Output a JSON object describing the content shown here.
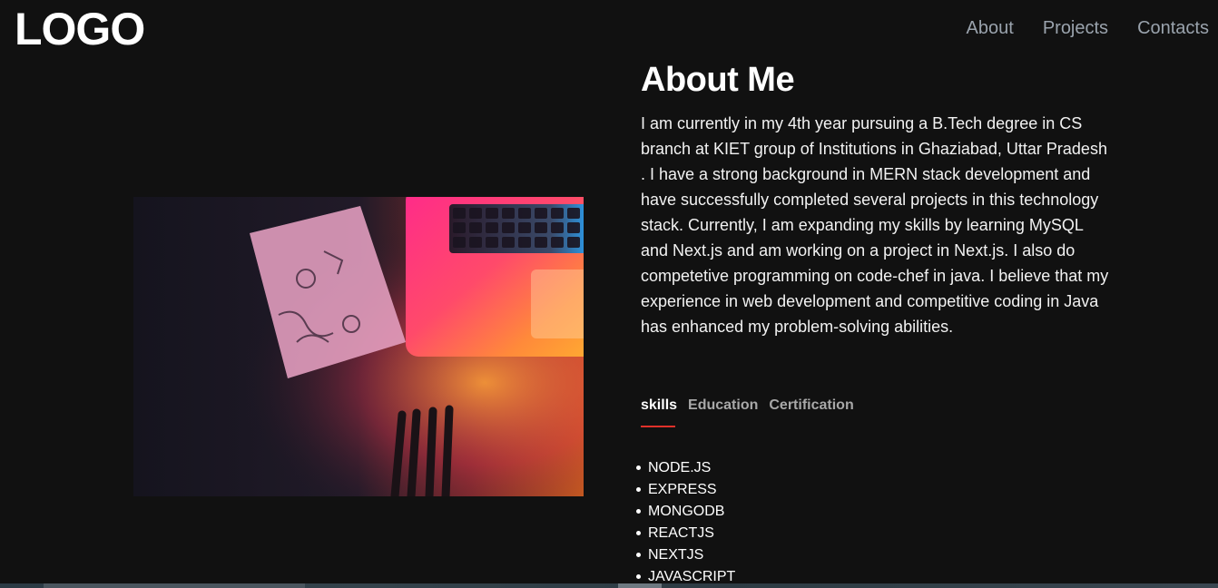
{
  "header": {
    "logo": "LOGO",
    "nav": [
      "About",
      "Projects",
      "Contacts"
    ]
  },
  "about": {
    "title": "About Me",
    "paragraph": "I am currently in my 4th year pursuing a B.Tech degree in CS branch at KIET group of Institutions in Ghaziabad, Uttar Pradesh . I have a strong background in MERN stack development and have successfully completed several projects in this technology stack. Currently, I am expanding my skills by learning MySQL and Next.js and am working on a project in Next.js. I also do competetive programming on code-chef in java. I believe that my experience in web development and competitive coding in Java has enhanced my problem-solving abilities."
  },
  "tabs": {
    "items": [
      "skills",
      "Education",
      "Certification"
    ],
    "active": "skills"
  },
  "skills": [
    "NODE.JS",
    "EXPRESS",
    "MONGODB",
    "REACTJS",
    "NEXTJS",
    "JAVASCRIPT"
  ],
  "colors": {
    "background": "#111111",
    "accent_underline": "#e0312a",
    "nav_text": "#9aa3ad"
  },
  "image": {
    "subject": "laptop keyboard under pink-orange light with notebook and pens"
  }
}
